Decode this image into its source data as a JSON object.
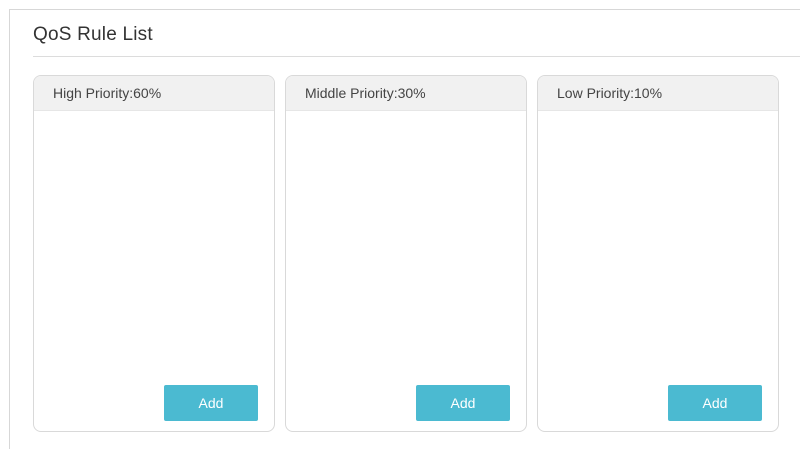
{
  "section": {
    "title": "QoS Rule List"
  },
  "panels": [
    {
      "header": "High Priority:60%",
      "add_label": "Add"
    },
    {
      "header": "Middle Priority:30%",
      "add_label": "Add"
    },
    {
      "header": "Low Priority:10%",
      "add_label": "Add"
    }
  ],
  "colors": {
    "button": "#4bbad1",
    "header_bg": "#f1f1f1"
  }
}
